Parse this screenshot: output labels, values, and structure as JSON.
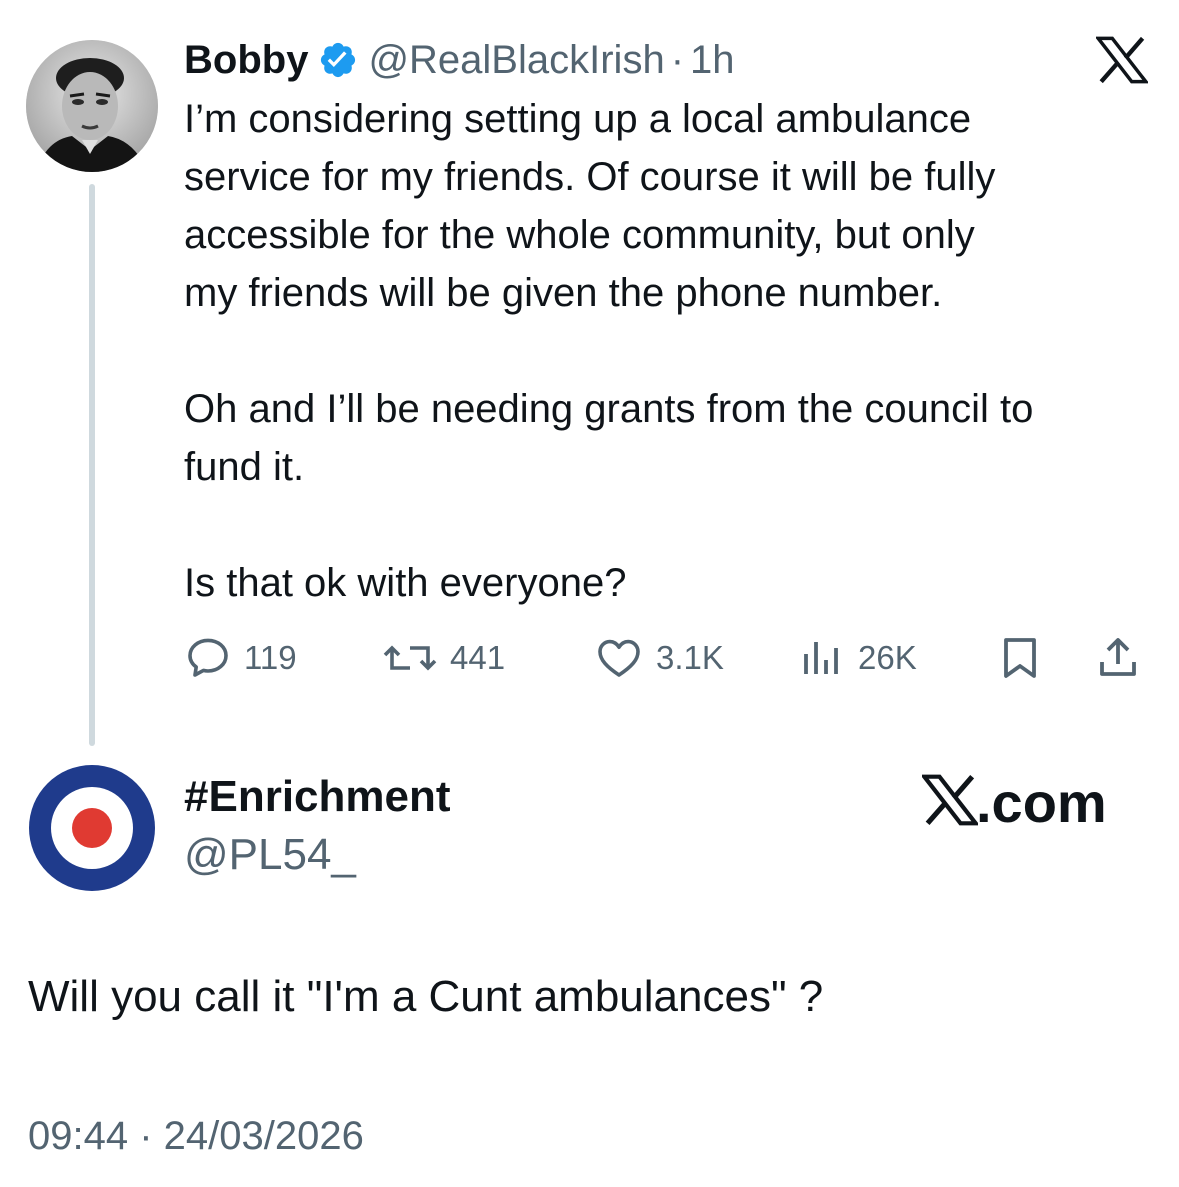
{
  "tweet": {
    "author_name": "Bobby",
    "author_handle": "@RealBlackIrish",
    "separator": "·",
    "time_ago": "1h",
    "text": "I’m considering setting up a local ambulance\nservice for my friends. Of course it will be fully\naccessible for the whole community, but only\nmy friends will be given the phone number.\n\nOh and I’ll be needing grants from the council to\nfund it.\n\nIs that ok with everyone?",
    "stats": {
      "replies": "119",
      "reposts": "441",
      "likes": "3.1K",
      "views": "26K"
    },
    "icons": {
      "verified": "verified-badge-icon",
      "platform": "x-logo-icon",
      "reply": "reply-icon",
      "repost": "repost-icon",
      "like": "heart-icon",
      "views": "views-icon",
      "bookmark": "bookmark-icon",
      "share": "share-icon"
    }
  },
  "reply": {
    "author_name": "#Enrichment",
    "author_handle": "@PL54_",
    "brand_text": ".com",
    "text": "Will you call it \"I'm a Cunt ambulances\" ?",
    "timestamp": "09:44 · 24/03/2026"
  },
  "colors": {
    "verified_blue": "#1d9bf0",
    "secondary_text": "#536471",
    "thread_line": "#cfd9de",
    "roundel_blue": "#1f3b8c",
    "roundel_red": "#e03a32"
  }
}
